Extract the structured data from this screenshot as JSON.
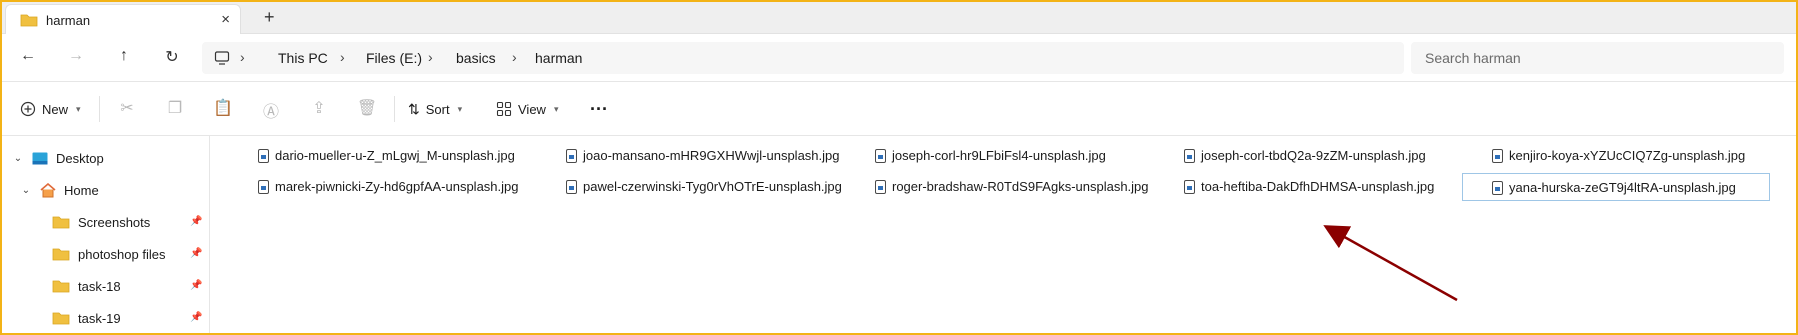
{
  "tab": {
    "title": "harman",
    "close_icon": "×",
    "new_tab_icon": "+"
  },
  "nav": {
    "back": "←",
    "forward": "→",
    "up": "↑",
    "refresh": "↻"
  },
  "breadcrumb": {
    "items": [
      "This PC",
      "Files (E:)",
      "basics",
      "harman"
    ],
    "separator": "›"
  },
  "search": {
    "placeholder": "Search harman"
  },
  "toolbar": {
    "new_label": "New",
    "sort_label": "Sort",
    "view_label": "View",
    "more_label": "···"
  },
  "sidebar": {
    "desktop": "Desktop",
    "home": "Home",
    "items": [
      "Screenshots",
      "photoshop files",
      "task-18",
      "task-19"
    ]
  },
  "files": [
    "dario-mueller-u-Z_mLgwj_M-unsplash.jpg",
    "joao-mansano-mHR9GXHWwjl-unsplash.jpg",
    "joseph-corl-hr9LFbiFsl4-unsplash.jpg",
    "joseph-corl-tbdQ2a-9zZM-unsplash.jpg",
    "kenjiro-koya-xYZUcCIQ7Zg-unsplash.jpg",
    "marek-piwnicki-Zy-hd6gpfAA-unsplash.jpg",
    "pawel-czerwinski-Tyg0rVhOTrE-unsplash.jpg",
    "roger-bradshaw-R0TdS9FAgks-unsplash.jpg",
    "toa-heftiba-DakDfhDHMSA-unsplash.jpg",
    "yana-hurska-zeGT9j4ltRA-unsplash.jpg"
  ],
  "colors": {
    "frame": "#f3b316",
    "arrow": "#8b0000",
    "selection_border": "#9fc6e6"
  }
}
